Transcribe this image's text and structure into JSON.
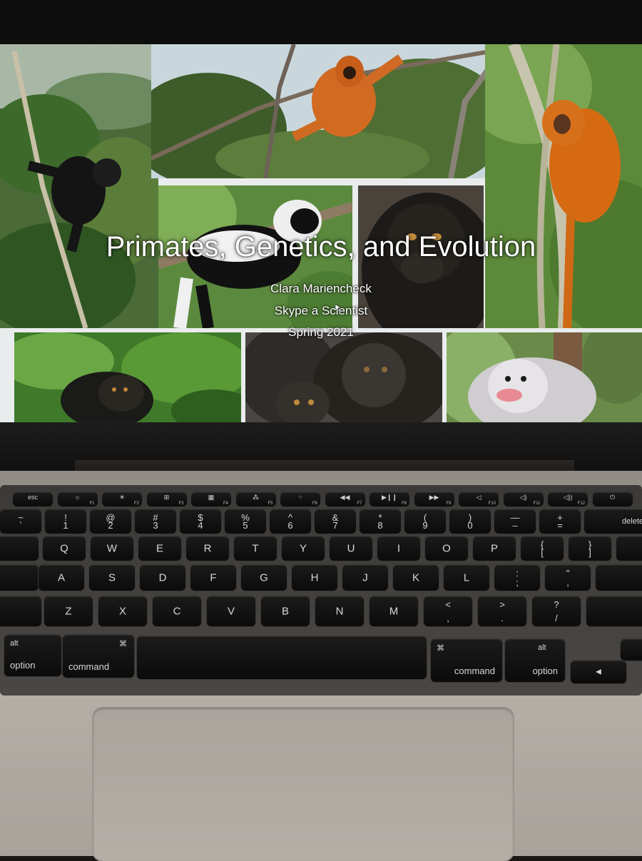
{
  "slide": {
    "title": "Primates, Genetics, and Evolution",
    "author": "Clara Mariencheck",
    "event": "Skype a Scientist",
    "date": "Spring 2021"
  },
  "photos": [
    {
      "id": "gorilla-tree",
      "subject": "gorilla"
    },
    {
      "id": "gibbon-branches",
      "subject": "gibbon"
    },
    {
      "id": "lemur",
      "subject": "ruffed lemur"
    },
    {
      "id": "macaque",
      "subject": "macaque"
    },
    {
      "id": "tamarin",
      "subject": "golden lion tamarin"
    },
    {
      "id": "gorilla-leaves",
      "subject": "gorilla"
    },
    {
      "id": "gorilla-family",
      "subject": "gorillas"
    },
    {
      "id": "snub-nosed-monkey",
      "subject": "snub-nosed monkey"
    }
  ],
  "keyboard": {
    "function_row": [
      {
        "main": "esc",
        "fn": ""
      },
      {
        "main": "☼",
        "fn": "F1"
      },
      {
        "main": "☀",
        "fn": "F2"
      },
      {
        "main": "⊞",
        "fn": "F3"
      },
      {
        "main": "▦",
        "fn": "F4"
      },
      {
        "main": "⁂",
        "fn": "F5"
      },
      {
        "main": "⁘",
        "fn": "F6"
      },
      {
        "main": "◀◀",
        "fn": "F7"
      },
      {
        "main": "▶❙❙",
        "fn": "F8"
      },
      {
        "main": "▶▶",
        "fn": "F9"
      },
      {
        "main": "◁",
        "fn": "F10"
      },
      {
        "main": "◁)",
        "fn": "F11"
      },
      {
        "main": "◁))",
        "fn": "F12"
      },
      {
        "main": "⏻",
        "fn": ""
      }
    ],
    "number_row": [
      {
        "top": "~",
        "bot": "`"
      },
      {
        "top": "!",
        "bot": "1"
      },
      {
        "top": "@",
        "bot": "2"
      },
      {
        "top": "#",
        "bot": "3"
      },
      {
        "top": "$",
        "bot": "4"
      },
      {
        "top": "%",
        "bot": "5"
      },
      {
        "top": "^",
        "bot": "6"
      },
      {
        "top": "&",
        "bot": "7"
      },
      {
        "top": "*",
        "bot": "8"
      },
      {
        "top": "(",
        "bot": "9"
      },
      {
        "top": ")",
        "bot": "0"
      },
      {
        "top": "—",
        "bot": "–"
      },
      {
        "top": "+",
        "bot": "="
      }
    ],
    "delete_label": "delete",
    "row_q": [
      "Q",
      "W",
      "E",
      "R",
      "T",
      "Y",
      "U",
      "I",
      "O",
      "P"
    ],
    "row_q_extra": [
      {
        "top": "{",
        "bot": "["
      },
      {
        "top": "}",
        "bot": "]"
      }
    ],
    "row_a": [
      "A",
      "S",
      "D",
      "F",
      "G",
      "H",
      "J",
      "K",
      "L"
    ],
    "row_a_extra": [
      {
        "top": ":",
        "bot": ";"
      },
      {
        "top": "\"",
        "bot": ","
      }
    ],
    "row_z": [
      "Z",
      "X",
      "C",
      "V",
      "B",
      "N",
      "M"
    ],
    "row_z_extra": [
      {
        "top": "<",
        "bot": ","
      },
      {
        "top": ">",
        "bot": "."
      },
      {
        "top": "?",
        "bot": "/"
      }
    ],
    "alt_label": "alt",
    "option_label": "option",
    "command_symbol": "⌘",
    "command_label": "command",
    "arrow_left": "◀"
  },
  "colors": {
    "bezel": "#111111",
    "deck": "#aaa49d",
    "key": "#111111",
    "title_text": "#ffffff"
  }
}
